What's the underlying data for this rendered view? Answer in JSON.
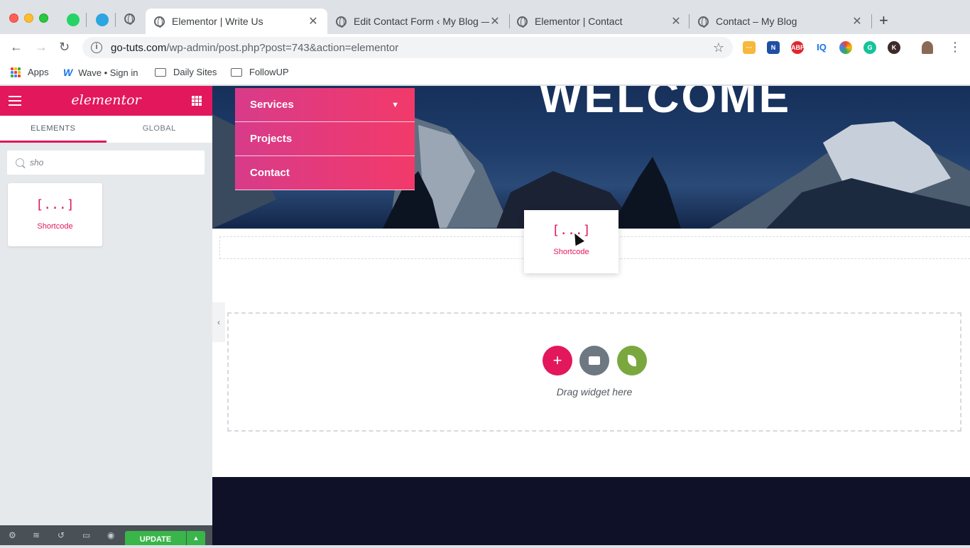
{
  "browser": {
    "tabs": [
      {
        "title": "Elementor | Write Us",
        "active": true
      },
      {
        "title": "Edit Contact Form ‹ My Blog —",
        "active": false
      },
      {
        "title": "Elementor | Contact",
        "active": false
      },
      {
        "title": "Contact – My Blog",
        "active": false
      }
    ],
    "url_host": "go-tuts.com",
    "url_path": "/wp-admin/post.php?post=743&action=elementor",
    "bookmarks": [
      {
        "label": "Apps",
        "icon": "apps-grid-icon"
      },
      {
        "label": "Wave • Sign in",
        "icon": "wave-icon"
      },
      {
        "label": "Daily Sites",
        "icon": "folder-icon"
      },
      {
        "label": "FollowUP",
        "icon": "folder-icon"
      }
    ]
  },
  "panel": {
    "brand": "elementor",
    "tabs": [
      "ELEMENTS",
      "GLOBAL"
    ],
    "search_value": "sho",
    "widget_label": "Shortcode",
    "widget_icon": "[...]",
    "update_label": "UPDATE"
  },
  "canvas": {
    "hero_title": "WELCOME",
    "menu_items": [
      "Services",
      "Projects",
      "Contact"
    ],
    "drag_widget_label": "Shortcode",
    "drag_widget_icon": "[...]",
    "drop_hint": "Drag widget here"
  },
  "colors": {
    "elementor_pink": "#e2175c",
    "update_green": "#39b54a",
    "template_gray": "#6d7882",
    "kit_green": "#7aa83f",
    "footer_navy": "#0e1128"
  }
}
